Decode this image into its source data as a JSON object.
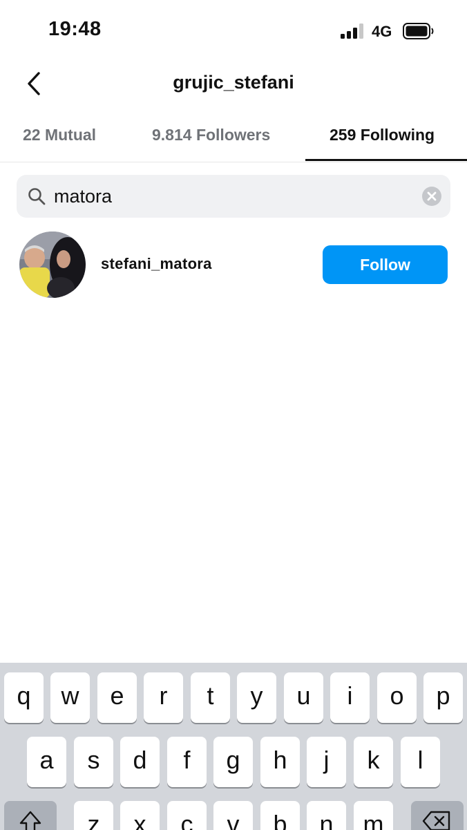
{
  "status_bar": {
    "time": "19:48",
    "network": "4G"
  },
  "header": {
    "title": "grujic_stefani"
  },
  "tabs": [
    {
      "label": "22 Mutual",
      "active": false
    },
    {
      "label": "9.814 Followers",
      "active": false
    },
    {
      "label": "259 Following",
      "active": true
    }
  ],
  "search": {
    "value": "matora"
  },
  "results": [
    {
      "username": "stefani_matora",
      "button_label": "Follow"
    }
  ],
  "keyboard": {
    "row1": [
      "q",
      "w",
      "e",
      "r",
      "t",
      "y",
      "u",
      "i",
      "o",
      "p"
    ],
    "row2": [
      "a",
      "s",
      "d",
      "f",
      "g",
      "h",
      "j",
      "k",
      "l"
    ],
    "row3": [
      "z",
      "x",
      "c",
      "v",
      "b",
      "n",
      "m"
    ]
  },
  "colors": {
    "accent": "#0095f6",
    "keyboard_bg": "#d3d6db"
  }
}
